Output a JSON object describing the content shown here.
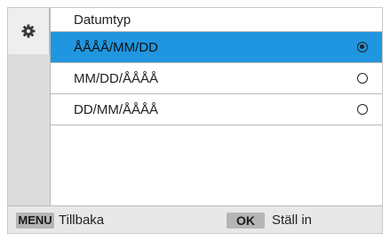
{
  "sidebar": {
    "active_tab_icon": "gear-icon"
  },
  "panel": {
    "title": "Datumtyp",
    "options": [
      {
        "label": "ÅÅÅÅ/MM/DD",
        "selected": true
      },
      {
        "label": "MM/DD/ÅÅÅÅ",
        "selected": false
      },
      {
        "label": "DD/MM/ÅÅÅÅ",
        "selected": false
      }
    ]
  },
  "footer": {
    "menu_key": "MENU",
    "back_label": "Tillbaka",
    "ok_key": "OK",
    "set_label": "Ställ in"
  },
  "colors": {
    "highlight": "#2196e0",
    "sidebar": "#dcdcdc",
    "footer": "#e8e8e8"
  }
}
